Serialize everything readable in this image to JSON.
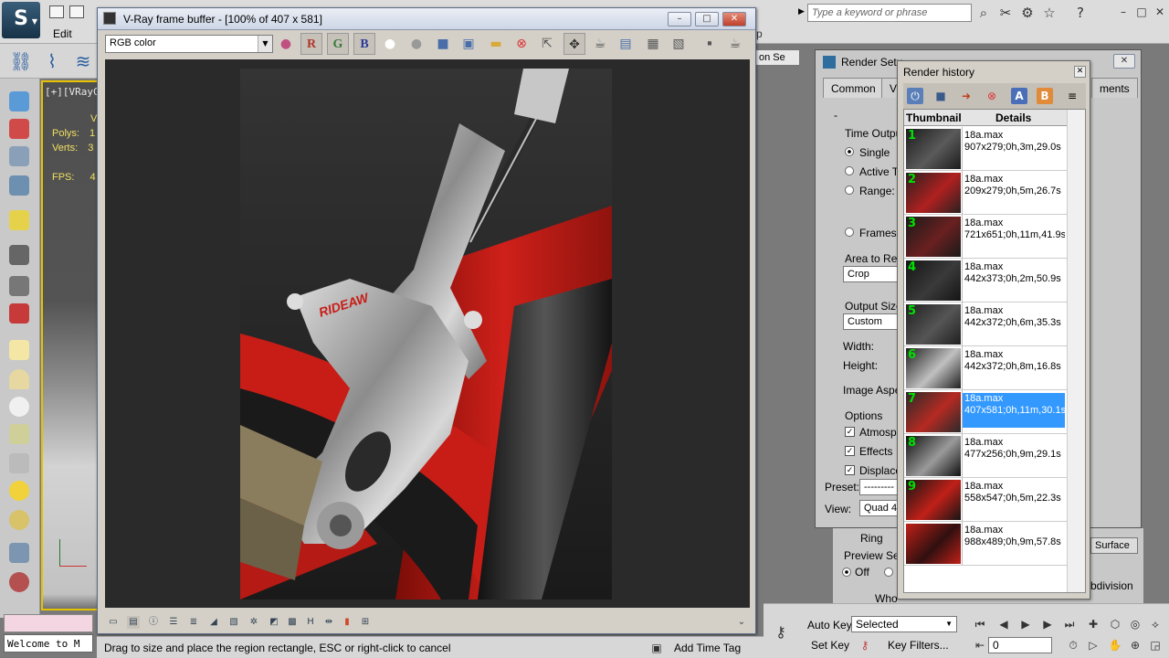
{
  "app": {
    "menu_edit": "Edit",
    "menu_fragment": "p",
    "search_placeholder": "Type a keyword or phrase"
  },
  "viewport": {
    "label": "[+][VRayC",
    "stats": [
      {
        "label": "Polys:",
        "value": "1"
      },
      {
        "label": "Verts:",
        "value": "3"
      },
      {
        "label": "FPS:",
        "value": "4"
      }
    ],
    "stats_header": "V"
  },
  "welcome_text": "Welcome to M",
  "vfb": {
    "title": "V-Ray frame buffer - [100% of 407 x 581]",
    "channel": "RGB color",
    "channel_buttons": [
      "R",
      "G",
      "B"
    ]
  },
  "render_setup": {
    "title": "Render Setu",
    "tabs": [
      "Common",
      "V",
      "ments"
    ],
    "dash": "-",
    "time_output": "Time Outpu",
    "single": "Single",
    "active_time": "Active T",
    "range": "Range:",
    "frames": "Frames",
    "area_to_render": "Area to Ren",
    "area_value": "Crop",
    "output_size": "Output Size",
    "output_value": "Custom",
    "width": "Width:",
    "height": "Height:",
    "image_aspect": "Image Aspe",
    "options": "Options",
    "atmospherics": "Atmosph",
    "effects": "Effects",
    "displacement": "Displace",
    "preset_label": "Preset:",
    "preset_value": "---------",
    "view_label": "View:",
    "view_value": "Quad 4",
    "ring": "Ring",
    "preview_sel": "Preview Sel",
    "off": "Off",
    "whole": "Who",
    "surface": "Surface",
    "subdivision": "bdivision",
    "viewport_sel": "on Se"
  },
  "render_history": {
    "title": "Render history",
    "col_thumbnail": "Thumbnail",
    "col_details": "Details",
    "selected_index": 6,
    "items": [
      {
        "num": "1",
        "file": "18a.max",
        "info": "907x279;0h,3m,29.0s"
      },
      {
        "num": "2",
        "file": "18a.max",
        "info": "209x279;0h,5m,26.7s"
      },
      {
        "num": "3",
        "file": "18a.max",
        "info": "721x651;0h,11m,41.9s"
      },
      {
        "num": "4",
        "file": "18a.max",
        "info": "442x373;0h,2m,50.9s"
      },
      {
        "num": "5",
        "file": "18a.max",
        "info": "442x372;0h,6m,35.3s"
      },
      {
        "num": "6",
        "file": "18a.max",
        "info": "442x372;0h,8m,16.8s"
      },
      {
        "num": "7",
        "file": "18a.max",
        "info": "407x581;0h,11m,30.1s"
      },
      {
        "num": "8",
        "file": "18a.max",
        "info": "477x256;0h,9m,29.1s"
      },
      {
        "num": "9",
        "file": "18a.max",
        "info": "558x547;0h,5m,22.3s"
      },
      {
        "num": "",
        "file": "18a.max",
        "info": "988x489;0h,9m,57.8s"
      }
    ]
  },
  "status": {
    "text": "Drag to size and place the region rectangle, ESC or right-click to cancel",
    "add_time_tag": "Add Time Tag"
  },
  "animation": {
    "auto_key": "Auto Key",
    "selected": "Selected",
    "set_key": "Set Key",
    "key_filters": "Key Filters...",
    "frame": "0"
  },
  "colors": {
    "accent_selection": "#3399ff",
    "history_number": "#00e000",
    "viewport_border": "#e6c200",
    "render_red": "#d0201a"
  }
}
